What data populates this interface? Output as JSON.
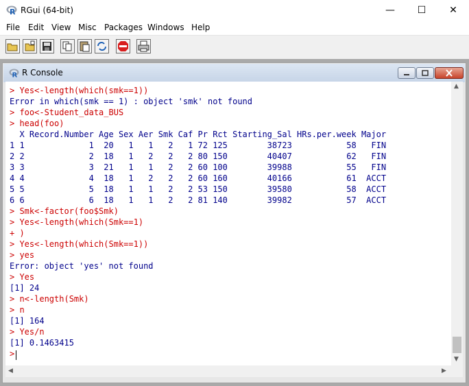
{
  "window": {
    "title": "RGui (64-bit)"
  },
  "menu": [
    "File",
    "Edit",
    "View",
    "Misc",
    "Packages",
    "Windows",
    "Help"
  ],
  "toolbar": [
    "open-script-icon",
    "load-workspace-icon",
    "save-icon",
    "copy-icon",
    "paste-icon",
    "copy-paste-icon",
    "stop-icon",
    "print-icon"
  ],
  "console": {
    "title": "R Console",
    "lines": [
      {
        "t": "> Yes<-length(which(smk==1))",
        "k": "cmd"
      },
      {
        "t": "Error in which(smk == 1) : object 'smk' not found",
        "k": "out"
      },
      {
        "t": "> foo<-Student_data_BUS",
        "k": "cmd"
      },
      {
        "t": "> head(foo)",
        "k": "cmd"
      },
      {
        "t": "  X Record.Number Age Sex Aer Smk Caf Pr Rct Starting_Sal HRs.per.week Major",
        "k": "out"
      },
      {
        "t": "1 1             1  20   1   1   2   1 72 125        38723           58   FIN",
        "k": "out"
      },
      {
        "t": "2 2             2  18   1   2   2   2 80 150        40407           62   FIN",
        "k": "out"
      },
      {
        "t": "3 3             3  21   1   1   2   2 60 100        39988           55   FIN",
        "k": "out"
      },
      {
        "t": "4 4             4  18   1   2   2   2 60 160        40166           61  ACCT",
        "k": "out"
      },
      {
        "t": "5 5             5  18   1   1   2   2 53 150        39580           58  ACCT",
        "k": "out"
      },
      {
        "t": "6 6             6  18   1   1   2   2 81 140        39982           57  ACCT",
        "k": "out"
      },
      {
        "t": "> Smk<-factor(foo$Smk)",
        "k": "cmd"
      },
      {
        "t": "> Yes<-length(which(Smk==1)",
        "k": "cmd"
      },
      {
        "t": "+ )",
        "k": "cmd"
      },
      {
        "t": "> Yes<-length(which(Smk==1))",
        "k": "cmd"
      },
      {
        "t": "> yes",
        "k": "cmd"
      },
      {
        "t": "Error: object 'yes' not found",
        "k": "out"
      },
      {
        "t": "> Yes",
        "k": "cmd"
      },
      {
        "t": "[1] 24",
        "k": "out"
      },
      {
        "t": "> n<-length(Smk)",
        "k": "cmd"
      },
      {
        "t": "> n",
        "k": "cmd"
      },
      {
        "t": "[1] 164",
        "k": "out"
      },
      {
        "t": "> Yes/n",
        "k": "cmd"
      },
      {
        "t": "[1] 0.1463415",
        "k": "out"
      },
      {
        "t": "> ",
        "k": "cmd"
      }
    ]
  }
}
